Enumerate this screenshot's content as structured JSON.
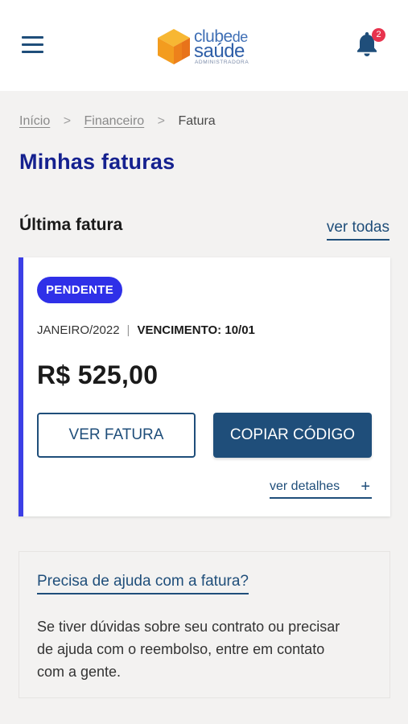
{
  "header": {
    "logo": {
      "line1_a": "clube",
      "line1_b": "de",
      "line2": "saúde",
      "line3": "ADMINISTRADORA"
    },
    "notifications_count": "2"
  },
  "breadcrumb": {
    "home": "Início",
    "financeiro": "Financeiro",
    "current": "Fatura",
    "separator": ">"
  },
  "page_title": "Minhas faturas",
  "last_invoice": {
    "section_title": "Última fatura",
    "see_all": "ver todas",
    "status": "PENDENTE",
    "month": "JANEIRO/2022",
    "due_label": "VENCIMENTO: 10/01",
    "amount": "R$ 525,00",
    "view_button": "VER FATURA",
    "copy_button": "COPIAR CÓDIGO",
    "details_link": "ver detalhes",
    "details_icon": "+"
  },
  "help": {
    "title": "Precisa de ajuda com a fatura?",
    "text": "Se tiver dúvidas sobre seu contrato ou precisar de ajuda com o reembolso, entre em contato com a gente."
  },
  "colors": {
    "primary": "#1f4e7a",
    "title": "#15218f",
    "status_badge": "#2f30e8",
    "card_accent": "#3c3fe6",
    "notification_badge": "#e8344e",
    "logo_orange": "#f39c1f"
  }
}
